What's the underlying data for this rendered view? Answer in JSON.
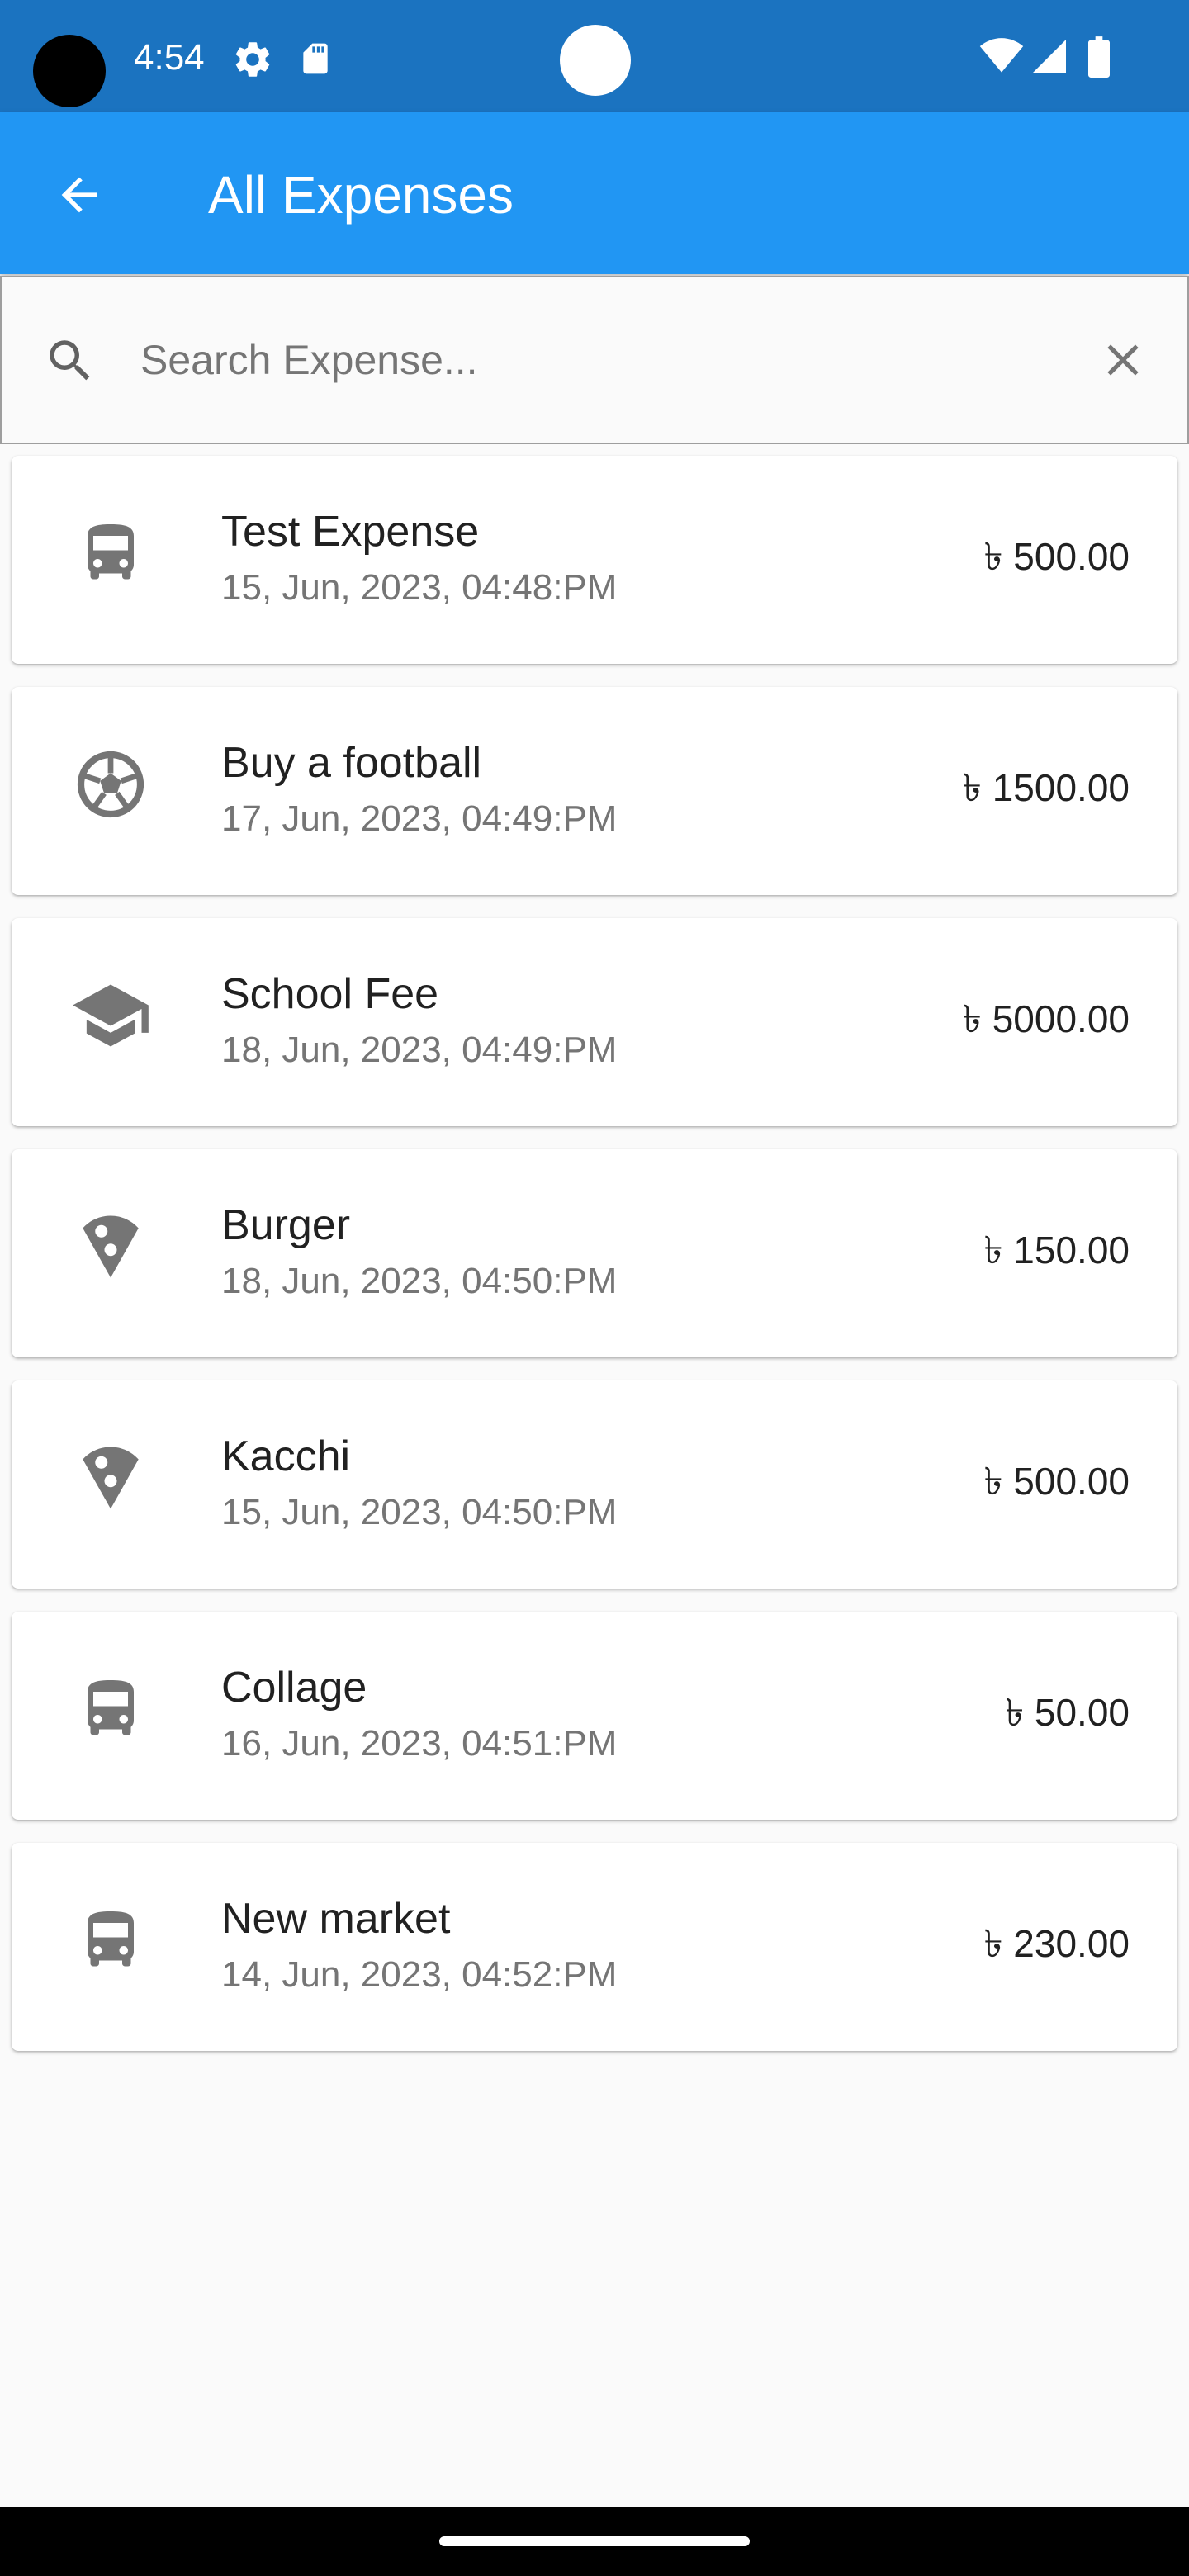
{
  "status_bar": {
    "time": "4:54",
    "icons": [
      "settings-icon",
      "sd-card-icon",
      "wifi-icon",
      "signal-icon",
      "battery-icon"
    ]
  },
  "app_bar": {
    "title": "All Expenses",
    "back_icon": "arrow-back-icon",
    "background_color": "#2196f3"
  },
  "search": {
    "placeholder": "Search Expense...",
    "value": "",
    "search_icon": "search-icon",
    "clear_icon": "close-icon"
  },
  "expenses": [
    {
      "title": "Test Expense",
      "date": "15, Jun, 2023, 04:48:PM",
      "amount": "৳ 500.00",
      "icon": "bus-icon"
    },
    {
      "title": "Buy a football",
      "date": "17, Jun, 2023, 04:49:PM",
      "amount": "৳ 1500.00",
      "icon": "football-icon"
    },
    {
      "title": "School Fee",
      "date": "18, Jun, 2023, 04:49:PM",
      "amount": "৳ 5000.00",
      "icon": "school-icon"
    },
    {
      "title": "Burger",
      "date": "18, Jun, 2023, 04:50:PM",
      "amount": "৳ 150.00",
      "icon": "pizza-icon"
    },
    {
      "title": "Kacchi",
      "date": "15, Jun, 2023, 04:50:PM",
      "amount": "৳ 500.00",
      "icon": "pizza-icon"
    },
    {
      "title": "Collage",
      "date": "16, Jun, 2023, 04:51:PM",
      "amount": "৳ 50.00",
      "icon": "bus-icon"
    },
    {
      "title": "New market",
      "date": "14, Jun, 2023, 04:52:PM",
      "amount": "৳ 230.00",
      "icon": "bus-icon"
    }
  ],
  "colors": {
    "status_bar": "#1b73c0",
    "app_bar": "#2196f3",
    "icon_gray": "#757575",
    "background": "#fafafa"
  }
}
